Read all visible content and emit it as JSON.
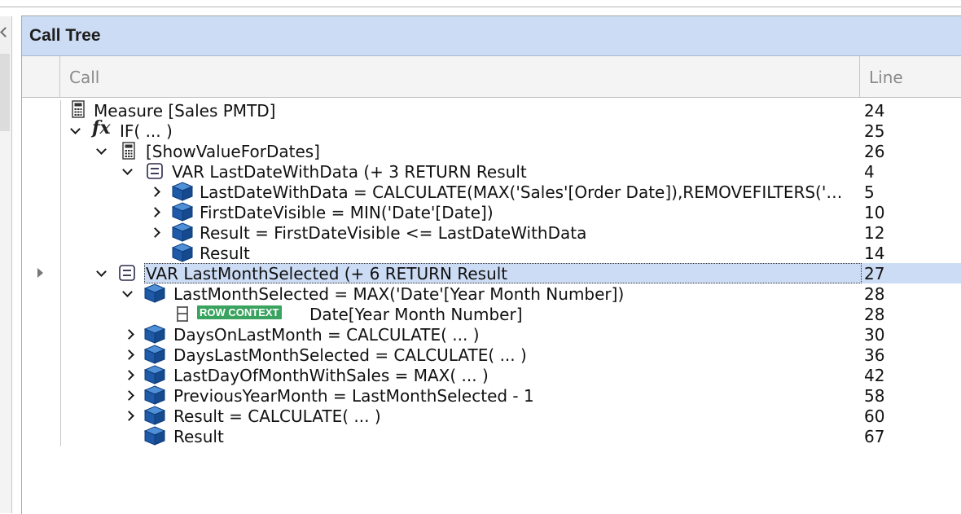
{
  "panel": {
    "title": "Call Tree"
  },
  "columns": {
    "call": "Call",
    "line": "Line"
  },
  "icons": {
    "measure": "calculator-icon",
    "function": "fx-icon",
    "variable": "variable-icon",
    "step": "cube-icon",
    "iterator": "iterator-icon"
  },
  "colors": {
    "title_bar": "#ccdcf4",
    "selection": "#ccdcf4",
    "badge": "#3aa35f",
    "cube": "#1e5aa8"
  },
  "rows": [
    {
      "text": "Measure [Sales PMTD]",
      "line": "24"
    },
    {
      "text": "IF( ... )",
      "line": "25"
    },
    {
      "text": "[ShowValueForDates]",
      "line": "26"
    },
    {
      "text": "VAR LastDateWithData  (+ 3 RETURN Result",
      "line": "4"
    },
    {
      "text": "LastDateWithData = CALCULATE(MAX('Sales'[Order Date]),REMOVEFILTERS('Sales'))",
      "line": "5"
    },
    {
      "text": "FirstDateVisible = MIN('Date'[Date])",
      "line": "10"
    },
    {
      "text": "Result = FirstDateVisible <= LastDateWithData",
      "line": "12"
    },
    {
      "text": "Result",
      "line": "14"
    },
    {
      "text": "VAR LastMonthSelected  (+ 6 RETURN Result",
      "line": "27"
    },
    {
      "text": "LastMonthSelected = MAX('Date'[Year Month Number])",
      "line": "28"
    },
    {
      "text": "Date[Year Month Number]",
      "line": "28",
      "badge": "ROW CONTEXT"
    },
    {
      "text": "DaysOnLastMonth = CALCULATE( ... )",
      "line": "30"
    },
    {
      "text": "DaysLastMonthSelected = CALCULATE( ... )",
      "line": "36"
    },
    {
      "text": "LastDayOfMonthWithSales = MAX( ... )",
      "line": "42"
    },
    {
      "text": "PreviousYearMonth = LastMonthSelected - 1",
      "line": "58"
    },
    {
      "text": "Result = CALCULATE( ... )",
      "line": "60"
    },
    {
      "text": "Result",
      "line": "67"
    }
  ]
}
